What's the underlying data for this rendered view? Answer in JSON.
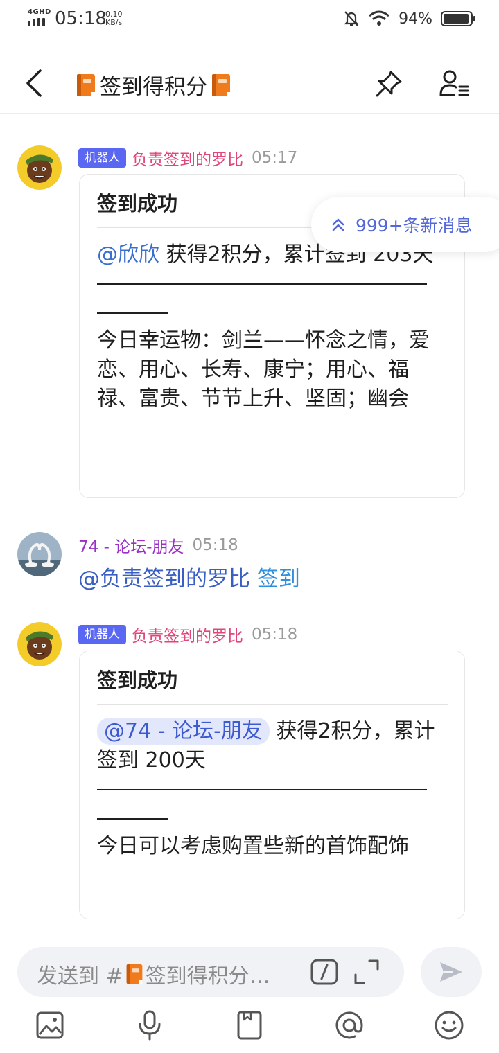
{
  "status_bar": {
    "network": "4GHD",
    "time": "05:18",
    "speed_value": "0.10",
    "speed_unit": "KB/s",
    "battery": "94%",
    "battery_level": 0.94
  },
  "header": {
    "title": "签到得积分"
  },
  "new_messages": {
    "label": "999+条新消息"
  },
  "messages": [
    {
      "tag": "机器人",
      "sender": "负责签到的罗比",
      "time": "05:17",
      "card_title": "签到成功",
      "mention": "@欣欣",
      "body_text": " 获得2积分，累计签到 203天",
      "extra_text": "今日幸运物：剑兰——怀念之情，爱恋、用心、长寿、康宁；用心、福禄、富贵、节节上升、坚固；幽会"
    },
    {
      "sender": "74 - 论坛-朋友",
      "time": "05:18",
      "mention": "@负责签到的罗比",
      "command": "签到"
    },
    {
      "tag": "机器人",
      "sender": "负责签到的罗比",
      "time": "05:18",
      "card_title": "签到成功",
      "mention": "@74 - 论坛-朋友",
      "body_text": " 获得2积分，累计签到 200天",
      "extra_text": "今日可以考虑购置些新的首饰配饰"
    }
  ],
  "composer": {
    "placeholder_prefix": "发送到 #",
    "placeholder_channel": "签到得积分…"
  },
  "colors": {
    "bot_tag": "#5a67f2",
    "bot_name": "#e0457b",
    "user_name": "#9b30c6",
    "mention": "#3a6fd0",
    "accent": "#5367d8"
  }
}
